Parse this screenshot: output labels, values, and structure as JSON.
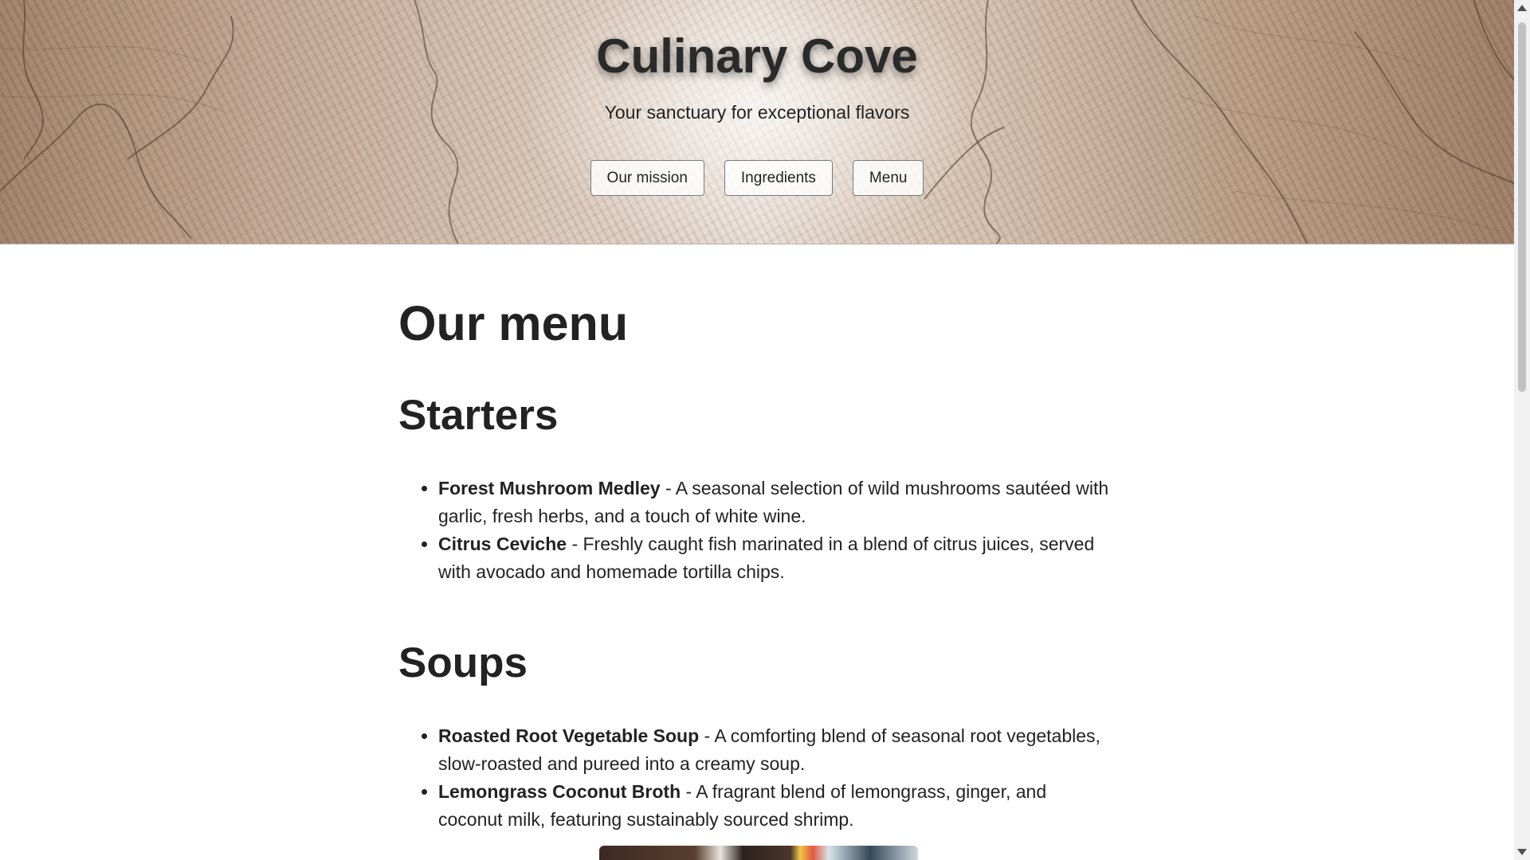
{
  "header": {
    "title": "Culinary Cove",
    "tagline": "Your sanctuary for exceptional flavors",
    "nav": [
      {
        "label": "Our mission"
      },
      {
        "label": "Ingredients"
      },
      {
        "label": "Menu"
      }
    ]
  },
  "main": {
    "heading": "Our menu",
    "sections": [
      {
        "title": "Starters",
        "items": [
          {
            "name": "Forest Mushroom Medley",
            "description": " - A seasonal selection of wild mushrooms sautéed with garlic, fresh herbs, and a touch of white wine."
          },
          {
            "name": "Citrus Ceviche",
            "description": " - Freshly caught fish marinated in a blend of citrus juices, served with avocado and homemade tortilla chips."
          }
        ]
      },
      {
        "title": "Soups",
        "items": [
          {
            "name": "Roasted Root Vegetable Soup",
            "description": " - A comforting blend of seasonal root vegetables, slow-roasted and pureed into a creamy soup."
          },
          {
            "name": "Lemongrass Coconut Broth",
            "description": " - A fragrant blend of lemongrass, ginger, and coconut milk, featuring sustainably sourced shrimp."
          }
        ]
      }
    ]
  },
  "colors": {
    "text": "#222222",
    "background": "#ffffff",
    "wood_light": "#e6dbd2",
    "wood_dark": "#9d8068"
  },
  "icons": [
    "scroll-up-arrow-icon",
    "scroll-down-arrow-icon"
  ]
}
